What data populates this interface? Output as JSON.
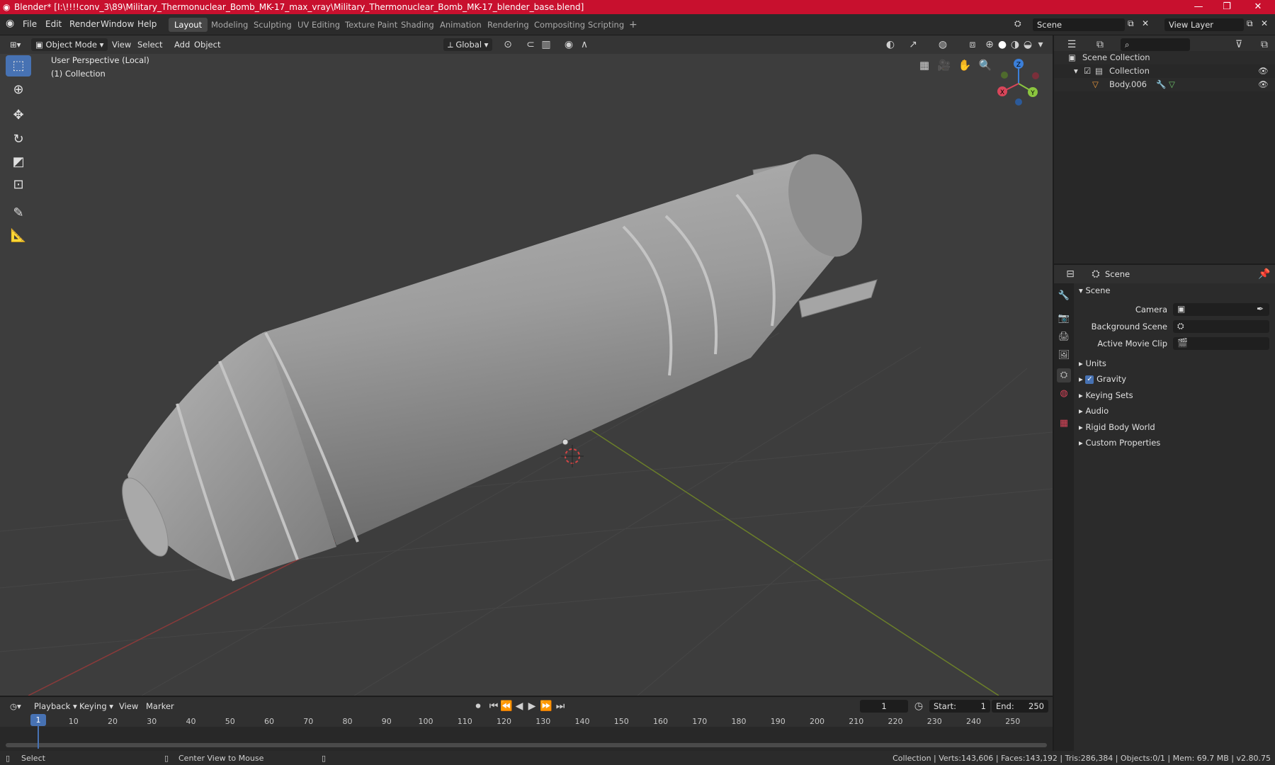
{
  "window": {
    "title": "Blender* [I:\\!!!!conv_3\\89\\Military_Thermonuclear_Bomb_MK-17_max_vray\\Military_Thermonuclear_Bomb_MK-17_blender_base.blend]",
    "minimize": "—",
    "maximize": "❐",
    "close": "✕"
  },
  "menu": [
    "File",
    "Edit",
    "Render",
    "Window",
    "Help"
  ],
  "workspaces": [
    "Layout",
    "Modeling",
    "Sculpting",
    "UV Editing",
    "Texture Paint",
    "Shading",
    "Animation",
    "Rendering",
    "Compositing",
    "Scripting"
  ],
  "active_workspace": "Layout",
  "scene_field": "Scene",
  "view_layer_field": "View Layer",
  "viewport": {
    "mode": "Object Mode",
    "menus": [
      "View",
      "Select",
      "Add",
      "Object"
    ],
    "orientation": "Global",
    "perspective_label": "User Perspective (Local)",
    "collection_label": "(1) Collection",
    "gizmo": {
      "x": "X",
      "y": "Y",
      "z": "Z"
    }
  },
  "tools": [
    "select-box-icon",
    "cursor-icon",
    "move-icon",
    "rotate-icon",
    "scale-icon",
    "transform-icon",
    "annotate-icon",
    "measure-icon"
  ],
  "outliner": {
    "root": "Scene Collection",
    "collection": "Collection",
    "object": "Body.006"
  },
  "properties": {
    "header": "Scene",
    "panel": "Scene",
    "camera_label": "Camera",
    "background_scene_label": "Background Scene",
    "active_movie_clip_label": "Active Movie Clip",
    "sections": [
      "Units",
      "Gravity",
      "Keying Sets",
      "Audio",
      "Rigid Body World",
      "Custom Properties"
    ],
    "gravity_checked": true
  },
  "timeline": {
    "menus": [
      "Playback",
      "Keying",
      "View",
      "Marker"
    ],
    "current_frame": "1",
    "start_label": "Start:",
    "start": "1",
    "end_label": "End:",
    "end": "250",
    "ticks": [
      "1",
      "10",
      "20",
      "30",
      "40",
      "50",
      "60",
      "70",
      "80",
      "90",
      "100",
      "110",
      "120",
      "130",
      "140",
      "150",
      "160",
      "170",
      "180",
      "190",
      "200",
      "210",
      "220",
      "230",
      "240",
      "250"
    ]
  },
  "status": {
    "select": "Select",
    "center_view": "Center View to Mouse",
    "stats": "Collection | Verts:143,606 | Faces:143,192 | Tris:286,384 | Objects:0/1 | Mem: 69.7 MB | v2.80.75"
  },
  "colors": {
    "title_bar": "#c8102e",
    "accent": "#4772b3",
    "x_axis": "#d9465a",
    "y_axis": "#8bc63f",
    "z_axis": "#3b7fd9"
  }
}
